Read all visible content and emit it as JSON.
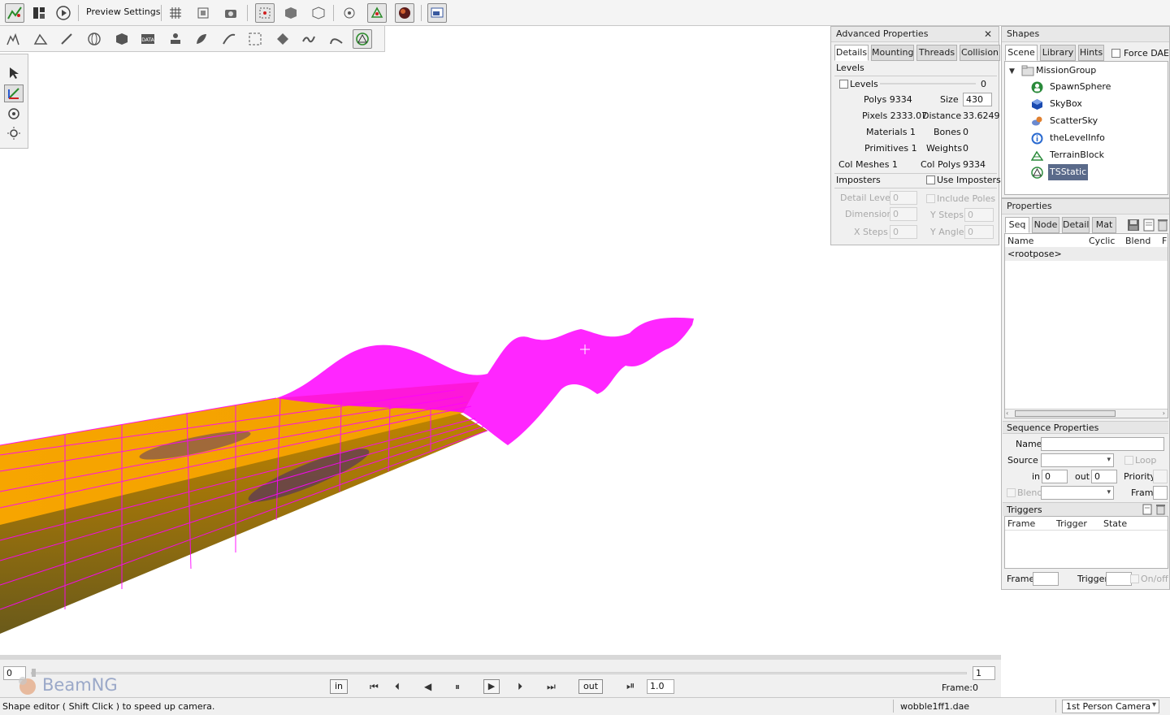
{
  "toolbar": {
    "preview_settings_label": "Preview Settings"
  },
  "advanced": {
    "title": "Advanced Properties",
    "tabs": [
      "Details",
      "Mounting",
      "Threads",
      "Collision"
    ],
    "levels_header": "Levels",
    "levels_checkbox": "Levels",
    "levels_value": "0",
    "polys_label": "Polys 9334",
    "size_label": "Size",
    "size_value": "430",
    "pixels_label": "Pixels 2333.07",
    "distance_label": "Distance",
    "distance_value": "33.6249",
    "materials_label": "Materials 1",
    "bones_label": "Bones",
    "bones_value": "0",
    "primitives_label": "Primitives 1",
    "weights_label": "Weights",
    "weights_value": "0",
    "colmeshes_label": "Col Meshes 1",
    "colpolys_label": "Col Polys",
    "colpolys_value": "9334",
    "imposters_header": "Imposters",
    "use_imposters": "Use Imposters",
    "detail_level_label": "Detail Level",
    "detail_level_value": "0",
    "include_poles": "Include Poles",
    "dimension_label": "Dimension",
    "dimension_value": "0",
    "ysteps_label": "Y Steps",
    "ysteps_value": "0",
    "xsteps_label": "X Steps",
    "xsteps_value": "0",
    "yangle_label": "Y Angle",
    "yangle_value": "0"
  },
  "shapes": {
    "title": "Shapes",
    "tabs": [
      "Scene",
      "Library",
      "Hints"
    ],
    "force_dae": "Force DAE",
    "tree_root": "MissionGroup",
    "tree_items": [
      "SpawnSphere",
      "SkyBox",
      "ScatterSky",
      "theLevelInfo",
      "TerrainBlock",
      "TSStatic"
    ]
  },
  "properties": {
    "title": "Properties",
    "tabs": [
      "Seq",
      "Node",
      "Detail",
      "Mat"
    ],
    "columns": [
      "Name",
      "Cyclic",
      "Blend",
      "F"
    ],
    "rows": [
      "<rootpose>"
    ],
    "seq_title": "Sequence Properties",
    "name_label": "Name",
    "source_label": "Source",
    "loop_label": "Loop",
    "in_label": "in",
    "in_value": "0",
    "out_label": "out",
    "out_value": "0",
    "priority_label": "Priority",
    "blend_label": "Blend",
    "frame_label": "Frame",
    "triggers_title": "Triggers",
    "trig_columns": [
      "Frame",
      "Trigger",
      "State"
    ],
    "trig_frame_label": "Frame",
    "trig_trigger_label": "Trigger",
    "onoff_label": "On/off"
  },
  "timeline": {
    "start_value": "0",
    "end_value": "1",
    "in_button": "in",
    "out_button": "out",
    "speed_value": "1.0",
    "frame_label": "Frame:",
    "frame_value": "0",
    "watermark": "BeamNG"
  },
  "status": {
    "message": "Shape editor ( Shift Click ) to speed up camera.",
    "filename": "wobble1ff1.dae",
    "camera": "1st Person Camera"
  },
  "colors": {
    "mesh_wire": "#ff00ff",
    "mesh_fill": "#f4a400",
    "selection": "#5a6a8a"
  }
}
